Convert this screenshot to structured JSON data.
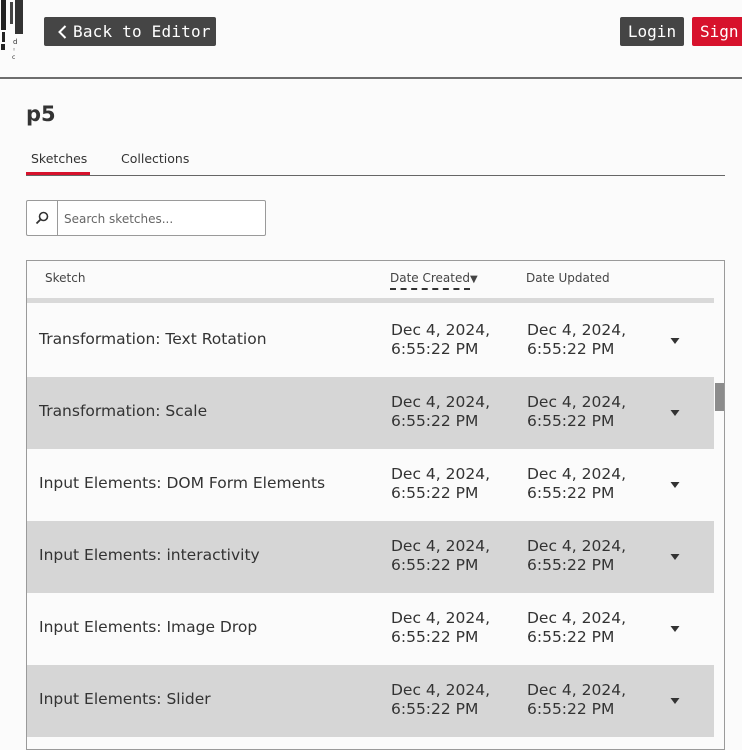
{
  "nav": {
    "back_label": "Back to Editor",
    "login_label": "Login",
    "signup_label": "Sign up"
  },
  "page": {
    "title": "p5"
  },
  "tabs": [
    {
      "label": "Sketches",
      "active": true
    },
    {
      "label": "Collections",
      "active": false
    }
  ],
  "search": {
    "placeholder": "Search sketches..."
  },
  "table": {
    "columns": [
      "Sketch",
      "Date Created",
      "Date Updated"
    ],
    "sort_indicator": "▼",
    "rows": [
      {
        "name": "Transformation: Text Rotation",
        "created": [
          "Dec 4, 2024,",
          "6:55:22 PM"
        ],
        "updated": [
          "Dec 4, 2024,",
          "6:55:22 PM"
        ]
      },
      {
        "name": "Transformation: Scale",
        "created": [
          "Dec 4, 2024,",
          "6:55:22 PM"
        ],
        "updated": [
          "Dec 4, 2024,",
          "6:55:22 PM"
        ]
      },
      {
        "name": "Input Elements: DOM Form Elements",
        "created": [
          "Dec 4, 2024,",
          "6:55:22 PM"
        ],
        "updated": [
          "Dec 4, 2024,",
          "6:55:22 PM"
        ]
      },
      {
        "name": "Input Elements: interactivity",
        "created": [
          "Dec 4, 2024,",
          "6:55:22 PM"
        ],
        "updated": [
          "Dec 4, 2024,",
          "6:55:22 PM"
        ]
      },
      {
        "name": "Input Elements: Image Drop",
        "created": [
          "Dec 4, 2024,",
          "6:55:22 PM"
        ],
        "updated": [
          "Dec 4, 2024,",
          "6:55:22 PM"
        ]
      },
      {
        "name": "Input Elements: Slider",
        "created": [
          "Dec 4, 2024,",
          "6:55:22 PM"
        ],
        "updated": [
          "Dec 4, 2024,",
          "6:55:22 PM"
        ]
      }
    ]
  },
  "colors": {
    "accent": "#d7122c",
    "dark_button": "#454545",
    "row_alt": "#d6d6d6"
  }
}
